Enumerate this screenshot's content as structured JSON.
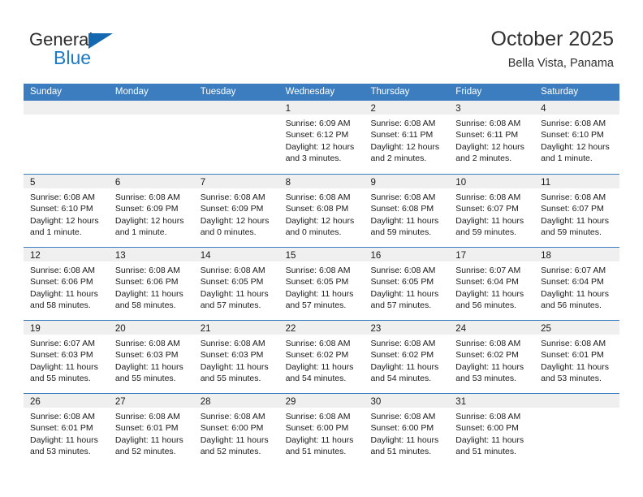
{
  "brand": {
    "line1": "General",
    "line2": "Blue",
    "flag_color": "#1368b0",
    "text_color": "#1a7ac7"
  },
  "header": {
    "title": "October 2025",
    "subtitle": "Bella Vista, Panama",
    "accent_color": "#3b7dbf",
    "band_color": "#efefef"
  },
  "weekdays": [
    "Sunday",
    "Monday",
    "Tuesday",
    "Wednesday",
    "Thursday",
    "Friday",
    "Saturday"
  ],
  "weeks": [
    [
      {
        "day": "",
        "sunrise": "",
        "sunset": "",
        "daylight1": "",
        "daylight2": ""
      },
      {
        "day": "",
        "sunrise": "",
        "sunset": "",
        "daylight1": "",
        "daylight2": ""
      },
      {
        "day": "",
        "sunrise": "",
        "sunset": "",
        "daylight1": "",
        "daylight2": ""
      },
      {
        "day": "1",
        "sunrise": "Sunrise: 6:09 AM",
        "sunset": "Sunset: 6:12 PM",
        "daylight1": "Daylight: 12 hours",
        "daylight2": "and 3 minutes."
      },
      {
        "day": "2",
        "sunrise": "Sunrise: 6:08 AM",
        "sunset": "Sunset: 6:11 PM",
        "daylight1": "Daylight: 12 hours",
        "daylight2": "and 2 minutes."
      },
      {
        "day": "3",
        "sunrise": "Sunrise: 6:08 AM",
        "sunset": "Sunset: 6:11 PM",
        "daylight1": "Daylight: 12 hours",
        "daylight2": "and 2 minutes."
      },
      {
        "day": "4",
        "sunrise": "Sunrise: 6:08 AM",
        "sunset": "Sunset: 6:10 PM",
        "daylight1": "Daylight: 12 hours",
        "daylight2": "and 1 minute."
      }
    ],
    [
      {
        "day": "5",
        "sunrise": "Sunrise: 6:08 AM",
        "sunset": "Sunset: 6:10 PM",
        "daylight1": "Daylight: 12 hours",
        "daylight2": "and 1 minute."
      },
      {
        "day": "6",
        "sunrise": "Sunrise: 6:08 AM",
        "sunset": "Sunset: 6:09 PM",
        "daylight1": "Daylight: 12 hours",
        "daylight2": "and 1 minute."
      },
      {
        "day": "7",
        "sunrise": "Sunrise: 6:08 AM",
        "sunset": "Sunset: 6:09 PM",
        "daylight1": "Daylight: 12 hours",
        "daylight2": "and 0 minutes."
      },
      {
        "day": "8",
        "sunrise": "Sunrise: 6:08 AM",
        "sunset": "Sunset: 6:08 PM",
        "daylight1": "Daylight: 12 hours",
        "daylight2": "and 0 minutes."
      },
      {
        "day": "9",
        "sunrise": "Sunrise: 6:08 AM",
        "sunset": "Sunset: 6:08 PM",
        "daylight1": "Daylight: 11 hours",
        "daylight2": "and 59 minutes."
      },
      {
        "day": "10",
        "sunrise": "Sunrise: 6:08 AM",
        "sunset": "Sunset: 6:07 PM",
        "daylight1": "Daylight: 11 hours",
        "daylight2": "and 59 minutes."
      },
      {
        "day": "11",
        "sunrise": "Sunrise: 6:08 AM",
        "sunset": "Sunset: 6:07 PM",
        "daylight1": "Daylight: 11 hours",
        "daylight2": "and 59 minutes."
      }
    ],
    [
      {
        "day": "12",
        "sunrise": "Sunrise: 6:08 AM",
        "sunset": "Sunset: 6:06 PM",
        "daylight1": "Daylight: 11 hours",
        "daylight2": "and 58 minutes."
      },
      {
        "day": "13",
        "sunrise": "Sunrise: 6:08 AM",
        "sunset": "Sunset: 6:06 PM",
        "daylight1": "Daylight: 11 hours",
        "daylight2": "and 58 minutes."
      },
      {
        "day": "14",
        "sunrise": "Sunrise: 6:08 AM",
        "sunset": "Sunset: 6:05 PM",
        "daylight1": "Daylight: 11 hours",
        "daylight2": "and 57 minutes."
      },
      {
        "day": "15",
        "sunrise": "Sunrise: 6:08 AM",
        "sunset": "Sunset: 6:05 PM",
        "daylight1": "Daylight: 11 hours",
        "daylight2": "and 57 minutes."
      },
      {
        "day": "16",
        "sunrise": "Sunrise: 6:08 AM",
        "sunset": "Sunset: 6:05 PM",
        "daylight1": "Daylight: 11 hours",
        "daylight2": "and 57 minutes."
      },
      {
        "day": "17",
        "sunrise": "Sunrise: 6:07 AM",
        "sunset": "Sunset: 6:04 PM",
        "daylight1": "Daylight: 11 hours",
        "daylight2": "and 56 minutes."
      },
      {
        "day": "18",
        "sunrise": "Sunrise: 6:07 AM",
        "sunset": "Sunset: 6:04 PM",
        "daylight1": "Daylight: 11 hours",
        "daylight2": "and 56 minutes."
      }
    ],
    [
      {
        "day": "19",
        "sunrise": "Sunrise: 6:07 AM",
        "sunset": "Sunset: 6:03 PM",
        "daylight1": "Daylight: 11 hours",
        "daylight2": "and 55 minutes."
      },
      {
        "day": "20",
        "sunrise": "Sunrise: 6:08 AM",
        "sunset": "Sunset: 6:03 PM",
        "daylight1": "Daylight: 11 hours",
        "daylight2": "and 55 minutes."
      },
      {
        "day": "21",
        "sunrise": "Sunrise: 6:08 AM",
        "sunset": "Sunset: 6:03 PM",
        "daylight1": "Daylight: 11 hours",
        "daylight2": "and 55 minutes."
      },
      {
        "day": "22",
        "sunrise": "Sunrise: 6:08 AM",
        "sunset": "Sunset: 6:02 PM",
        "daylight1": "Daylight: 11 hours",
        "daylight2": "and 54 minutes."
      },
      {
        "day": "23",
        "sunrise": "Sunrise: 6:08 AM",
        "sunset": "Sunset: 6:02 PM",
        "daylight1": "Daylight: 11 hours",
        "daylight2": "and 54 minutes."
      },
      {
        "day": "24",
        "sunrise": "Sunrise: 6:08 AM",
        "sunset": "Sunset: 6:02 PM",
        "daylight1": "Daylight: 11 hours",
        "daylight2": "and 53 minutes."
      },
      {
        "day": "25",
        "sunrise": "Sunrise: 6:08 AM",
        "sunset": "Sunset: 6:01 PM",
        "daylight1": "Daylight: 11 hours",
        "daylight2": "and 53 minutes."
      }
    ],
    [
      {
        "day": "26",
        "sunrise": "Sunrise: 6:08 AM",
        "sunset": "Sunset: 6:01 PM",
        "daylight1": "Daylight: 11 hours",
        "daylight2": "and 53 minutes."
      },
      {
        "day": "27",
        "sunrise": "Sunrise: 6:08 AM",
        "sunset": "Sunset: 6:01 PM",
        "daylight1": "Daylight: 11 hours",
        "daylight2": "and 52 minutes."
      },
      {
        "day": "28",
        "sunrise": "Sunrise: 6:08 AM",
        "sunset": "Sunset: 6:00 PM",
        "daylight1": "Daylight: 11 hours",
        "daylight2": "and 52 minutes."
      },
      {
        "day": "29",
        "sunrise": "Sunrise: 6:08 AM",
        "sunset": "Sunset: 6:00 PM",
        "daylight1": "Daylight: 11 hours",
        "daylight2": "and 51 minutes."
      },
      {
        "day": "30",
        "sunrise": "Sunrise: 6:08 AM",
        "sunset": "Sunset: 6:00 PM",
        "daylight1": "Daylight: 11 hours",
        "daylight2": "and 51 minutes."
      },
      {
        "day": "31",
        "sunrise": "Sunrise: 6:08 AM",
        "sunset": "Sunset: 6:00 PM",
        "daylight1": "Daylight: 11 hours",
        "daylight2": "and 51 minutes."
      },
      {
        "day": "",
        "sunrise": "",
        "sunset": "",
        "daylight1": "",
        "daylight2": ""
      }
    ]
  ]
}
